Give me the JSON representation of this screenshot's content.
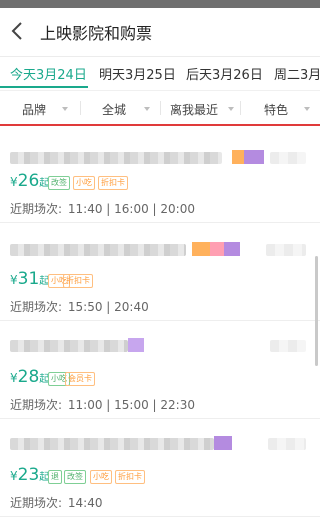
{
  "header": {
    "title": "上映影院和购票",
    "back_icon": "back-arrow-icon"
  },
  "dates": [
    {
      "label": "今天3月24日",
      "active": true
    },
    {
      "label": "明天3月25日",
      "active": false
    },
    {
      "label": "后天3月26日",
      "active": false
    },
    {
      "label": "周二3月",
      "active": false
    }
  ],
  "filters": [
    {
      "label": "品牌"
    },
    {
      "label": "全城"
    },
    {
      "label": "离我最近"
    },
    {
      "label": "特色"
    }
  ],
  "colors": {
    "accent": "#1aa98c",
    "divider_red": "#e03a3a",
    "tag_green": "#4fb06b",
    "tag_orange": "#ff9c3a"
  },
  "cinemas": [
    {
      "price_currency": "¥",
      "price": "26",
      "price_suffix": "起",
      "tags": [
        "改签",
        "小吃",
        "折扣卡"
      ],
      "times_label": "近期场次:",
      "times": "11:40 | 16:00 | 20:00"
    },
    {
      "price_currency": "¥",
      "price": "31",
      "price_suffix": "起",
      "tags": [
        "小吃",
        "折扣卡"
      ],
      "times_label": "近期场次:",
      "times": "15:50 | 20:40"
    },
    {
      "price_currency": "¥",
      "price": "28",
      "price_suffix": "起",
      "tags": [
        "小吃",
        "会员卡"
      ],
      "times_label": "近期场次:",
      "times": "11:00 | 15:00 | 22:30"
    },
    {
      "price_currency": "¥",
      "price": "23",
      "price_suffix": "起",
      "tags": [
        "退",
        "改签",
        "小吃",
        "折扣卡"
      ],
      "times_label": "近期场次:",
      "times": "14:40"
    }
  ]
}
